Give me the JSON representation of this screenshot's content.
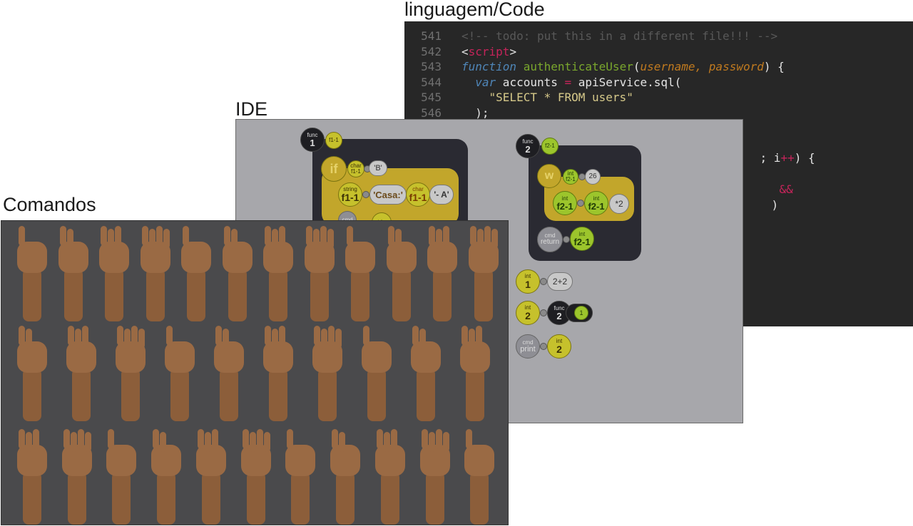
{
  "titles": {
    "code": "linguagem/Code",
    "ide": "IDE",
    "commands": "Comandos"
  },
  "code": {
    "lines": [
      {
        "num": "541",
        "tokens": [
          {
            "t": "<!-- todo: put this in a different file!!! -->",
            "c": "c-cmt"
          }
        ]
      },
      {
        "num": "542",
        "tokens": [
          {
            "t": "<",
            "c": "c-tag"
          },
          {
            "t": "script",
            "c": "c-tagname"
          },
          {
            "t": ">",
            "c": "c-tag"
          }
        ]
      },
      {
        "num": "543",
        "tokens": [
          {
            "t": "function",
            "c": "c-kw"
          },
          {
            "t": " ",
            "c": "c-plain"
          },
          {
            "t": "authenticateUser",
            "c": "c-fn"
          },
          {
            "t": "(",
            "c": "c-plain"
          },
          {
            "t": "username, password",
            "c": "c-param"
          },
          {
            "t": ") {",
            "c": "c-plain"
          }
        ]
      },
      {
        "num": "544",
        "tokens": [
          {
            "t": "  ",
            "c": "c-plain"
          },
          {
            "t": "var",
            "c": "c-kw"
          },
          {
            "t": " accounts ",
            "c": "c-plain"
          },
          {
            "t": "=",
            "c": "c-op"
          },
          {
            "t": " apiService.sql(",
            "c": "c-plain"
          }
        ]
      },
      {
        "num": "545",
        "tokens": [
          {
            "t": "    \"SELECT * FROM users\"",
            "c": "c-str"
          }
        ]
      },
      {
        "num": "546",
        "tokens": [
          {
            "t": "  );",
            "c": "c-plain"
          }
        ]
      }
    ],
    "fragments": [
      {
        "text": "; i",
        "c": "c-plain"
      },
      {
        "text": "++",
        "c": "c-op"
      },
      {
        "text": ") {",
        "c": "c-plain"
      },
      {
        "text": "&&",
        "c": "c-op"
      },
      {
        "text": ")",
        "c": "c-plain"
      }
    ]
  },
  "ide": {
    "func1": {
      "type_label": "func",
      "num": "1",
      "ref": "f1-1"
    },
    "if_label": "if",
    "cond": {
      "type_label": "char",
      "var": "f1-1",
      "val": "'B'"
    },
    "string_label": "string",
    "f1": "f1-1",
    "casa": "'Casa:'",
    "char_label": "char",
    "dash_a": "'- A'",
    "cmd_label": "cmd",
    "func2": {
      "type_label": "func",
      "num": "2",
      "ref": "f2-1"
    },
    "w_label": "w",
    "w_cond": {
      "type_label": "int",
      "var": "f2-1",
      "val": "26"
    },
    "int_label": "int",
    "f2": "f2-1",
    "times2": "*2",
    "return_label": "return",
    "row1": {
      "type_label": "int",
      "num": "1",
      "expr": "2+2"
    },
    "row2": {
      "type_label": "int",
      "num": "2",
      "call_label": "func",
      "call_num": "2",
      "arg": "1"
    },
    "row3": {
      "cmd": "print",
      "type_label": "int",
      "num": "2"
    }
  }
}
